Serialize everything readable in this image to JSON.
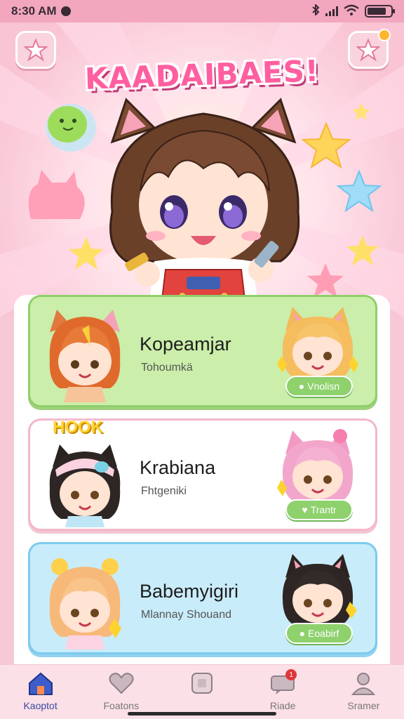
{
  "status_bar": {
    "time": "8:30 AM",
    "icons": [
      "bluetooth-icon",
      "signal-icon",
      "wifi-icon",
      "battery-icon"
    ]
  },
  "hero": {
    "title": "KAADAIBAES!",
    "left_button_icon": "star-icon",
    "right_button_icon": "star-icon"
  },
  "cards": [
    {
      "title": "Kopeamjar",
      "subtitle": "Tohoumkä",
      "chip": "Vnolisn",
      "theme": "#cbeeaa"
    },
    {
      "title": "Krabiana",
      "subtitle": "Fhtgeniki",
      "chip": "Trantr",
      "badge": "HOOK",
      "theme": "#ffffff"
    },
    {
      "title": "Babemyigiri",
      "subtitle": "Mlannay Shouand",
      "chip": "Eoabirf",
      "theme": "#c9ecfa"
    }
  ],
  "nav": [
    {
      "label": "Kaoptot",
      "icon": "home-icon",
      "active": true
    },
    {
      "label": "Foatons",
      "icon": "heart-icon",
      "active": false
    },
    {
      "label": "",
      "icon": "square-icon",
      "active": false
    },
    {
      "label": "Riade",
      "icon": "chat-icon",
      "active": false,
      "badge": "1"
    },
    {
      "label": "Sramer",
      "icon": "profile-icon",
      "active": false
    }
  ],
  "colors": {
    "accent": "#ff5fa0",
    "status_bar": "#f2a7bf",
    "chip": "#8ed16d"
  }
}
